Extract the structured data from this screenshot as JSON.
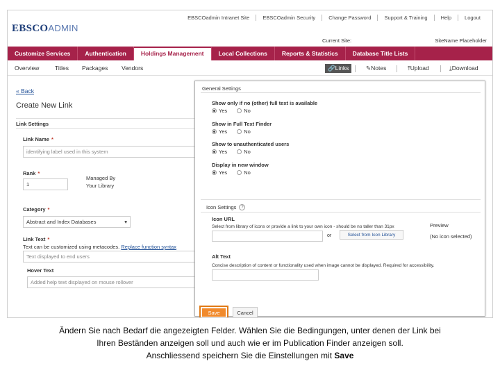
{
  "toplinks": [
    "EBSCOadmin Intranet Site",
    "EBSCOadmin Security",
    "Change Password",
    "Support & Training",
    "Help",
    "Logout"
  ],
  "logo": {
    "a": "EBSCO",
    "b": "ADMIN"
  },
  "current_site": {
    "label": "Current Site:",
    "value": "SiteName Placeholder"
  },
  "mainnav": [
    "Customize Services",
    "Authentication",
    "Holdings Management",
    "Local Collections",
    "Reports & Statistics",
    "Database Title Lists"
  ],
  "subnav": {
    "items": [
      "Overview",
      "Titles",
      "Packages",
      "Vendors"
    ],
    "tools": {
      "links": "Links",
      "notes": "Notes",
      "upload": "Upload",
      "download": "Download"
    }
  },
  "form": {
    "back": "« Back",
    "title": "Create New Link",
    "link_settings": "Link Settings",
    "link_name_label": "Link Name",
    "link_name_placeholder": "identifying label used in this system",
    "rank_label": "Rank",
    "rank_value": "1",
    "managed_by_label": "Managed By",
    "managed_by_value": "Your Library",
    "category_label": "Category",
    "category_value": "Abstract and Index Databases",
    "link_text_label": "Link Text",
    "link_text_note": "Text can be customized using metacodes.",
    "link_text_note_link": "Replace function syntax",
    "link_text_placeholder": "Text displayed to end users",
    "hover_text_label": "Hover Text",
    "hover_text_placeholder": "Added help text displayed on mouse rollover",
    "required_mark": "*"
  },
  "dialog": {
    "general_settings": "General Settings",
    "questions": [
      "Show only if no (other) full text is available",
      "Show in Full Text Finder",
      "Show to unauthenticated users",
      "Display in new window"
    ],
    "yes": "Yes",
    "no": "No",
    "icon_settings": "Icon Settings",
    "qmark": "?",
    "icon_url_label": "Icon URL",
    "icon_url_text": "Select from library of icons or provide a link to your own icon - should be no taller than 31px",
    "or": "or",
    "select_icon": "Select from Icon Library",
    "preview_label": "Preview",
    "preview_value": "(No icon selected)",
    "alt_text_label": "Alt Text",
    "alt_text_text": "Concise description of content or functionality used when image cannot be displayed. Required for accessibility.",
    "save": "Save",
    "cancel": "Cancel"
  },
  "caption": {
    "line1": "Ändern Sie nach Bedarf die angezeigten Felder.  Wählen Sie die Bedingungen, unter denen der Link bei",
    "line2": "Ihren Beständen anzeigen soll und auch wie er im Publication Finder anzeigen soll.",
    "line3_pre": "Anschliessend speichern Sie die Einstellungen mit ",
    "line3_bold": "Save"
  },
  "colors": {
    "accent": "#a6224a",
    "save": "#f18a2c",
    "link": "#1f4f96"
  }
}
